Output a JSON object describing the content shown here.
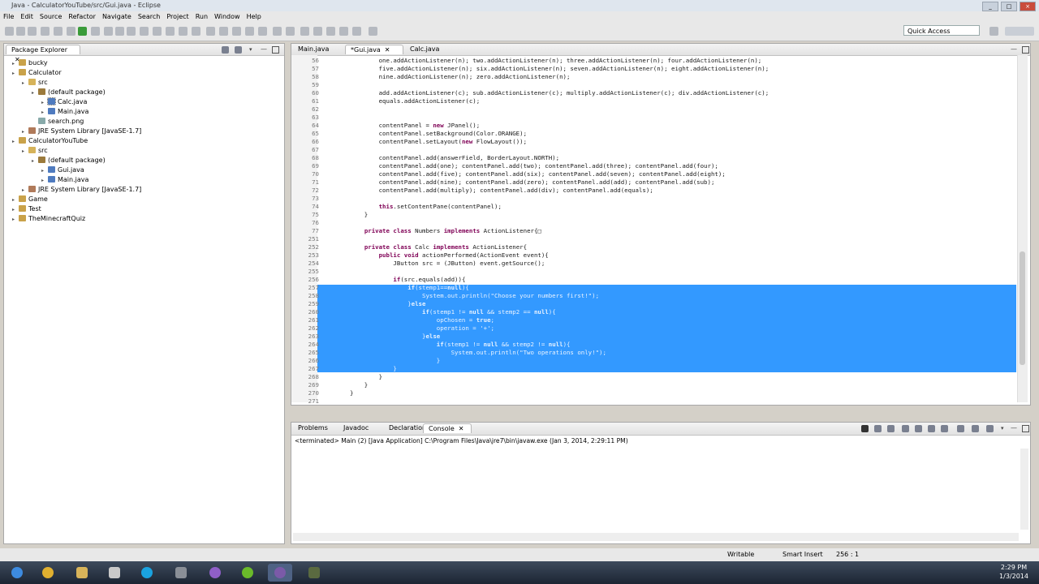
{
  "window": {
    "title": "Java - CalculatorYouTube/src/Gui.java - Eclipse",
    "title_clip": "CalculatorYouTube/src/Gui.java - Eclipse"
  },
  "menu": [
    "File",
    "Edit",
    "Source",
    "Refactor",
    "Navigate",
    "Search",
    "Project",
    "Run",
    "Window",
    "Help"
  ],
  "toolbar": {
    "quick_access": "Quick Access"
  },
  "package_explorer": {
    "tab_label": "Package Explorer",
    "tree": [
      {
        "label": "bucky",
        "depth": 0,
        "icon": "project-icon"
      },
      {
        "label": "Calculator",
        "depth": 0,
        "icon": "project-icon"
      },
      {
        "label": "src",
        "depth": 1,
        "icon": "source-folder-icon"
      },
      {
        "label": "(default package)",
        "depth": 2,
        "icon": "package-icon"
      },
      {
        "label": "Calc.java",
        "depth": 3,
        "icon": "java-file-icon"
      },
      {
        "label": "Main.java",
        "depth": 3,
        "icon": "java-file-icon"
      },
      {
        "label": "search.png",
        "depth": 2,
        "icon": "image-file-icon"
      },
      {
        "label": "JRE System Library [JavaSE-1.7]",
        "depth": 1,
        "icon": "library-icon"
      },
      {
        "label": "CalculatorYouTube",
        "depth": 0,
        "icon": "project-icon"
      },
      {
        "label": "src",
        "depth": 1,
        "icon": "source-folder-icon"
      },
      {
        "label": "(default package)",
        "depth": 2,
        "icon": "package-icon"
      },
      {
        "label": "Gui.java",
        "depth": 3,
        "icon": "java-file-icon"
      },
      {
        "label": "Main.java",
        "depth": 3,
        "icon": "java-file-icon"
      },
      {
        "label": "JRE System Library [JavaSE-1.7]",
        "depth": 1,
        "icon": "library-icon"
      },
      {
        "label": "Game",
        "depth": 0,
        "icon": "project-icon"
      },
      {
        "label": "Test",
        "depth": 0,
        "icon": "project-icon"
      },
      {
        "label": "TheMinecraftQuiz",
        "depth": 0,
        "icon": "project-icon"
      }
    ]
  },
  "editor": {
    "tabs": [
      "Main.java",
      "*Gui.java",
      "Calc.java"
    ],
    "active_tab": 1,
    "lines": [
      {
        "n": "56",
        "code": "        one.addActionListener(n); two.addActionListener(n); three.addActionListener(n); four.addActionListener(n);"
      },
      {
        "n": "57",
        "code": "        five.addActionListener(n); six.addActionListener(n); seven.addActionListener(n); eight.addActionListener(n);"
      },
      {
        "n": "58",
        "code": "        nine.addActionListener(n); zero.addActionListener(n);"
      },
      {
        "n": "59",
        "code": ""
      },
      {
        "n": "60",
        "code": "        add.addActionListener(c); sub.addActionListener(c); multiply.addActionListener(c); div.addActionListener(c);"
      },
      {
        "n": "61",
        "code": "        equals.addActionListener(c);"
      },
      {
        "n": "62",
        "code": ""
      },
      {
        "n": "63",
        "code": ""
      },
      {
        "n": "64",
        "code": "        contentPanel = new JPanel();"
      },
      {
        "n": "65",
        "code": "        contentPanel.setBackground(Color.ORANGE);"
      },
      {
        "n": "66",
        "code": "        contentPanel.setLayout(new FlowLayout());"
      },
      {
        "n": "67",
        "code": ""
      },
      {
        "n": "68",
        "code": "        contentPanel.add(answerField, BorderLayout.NORTH);"
      },
      {
        "n": "69",
        "code": "        contentPanel.add(one); contentPanel.add(two); contentPanel.add(three); contentPanel.add(four);"
      },
      {
        "n": "70",
        "code": "        contentPanel.add(five); contentPanel.add(six); contentPanel.add(seven); contentPanel.add(eight);"
      },
      {
        "n": "71",
        "code": "        contentPanel.add(nine); contentPanel.add(zero); contentPanel.add(add); contentPanel.add(sub);"
      },
      {
        "n": "72",
        "code": "        contentPanel.add(multiply); contentPanel.add(div); contentPanel.add(equals);"
      },
      {
        "n": "73",
        "code": ""
      },
      {
        "n": "74",
        "code": "        this.setContentPane(contentPanel);"
      },
      {
        "n": "75",
        "code": "    }"
      },
      {
        "n": "76",
        "code": ""
      },
      {
        "n": "77",
        "code": "    private class Numbers implements ActionListener{□"
      },
      {
        "n": "251",
        "code": ""
      },
      {
        "n": "252",
        "code": "    private class Calc implements ActionListener{"
      },
      {
        "n": "253",
        "code": "        public void actionPerformed(ActionEvent event){"
      },
      {
        "n": "254",
        "code": "            JButton src = (JButton) event.getSource();"
      },
      {
        "n": "255",
        "code": ""
      },
      {
        "n": "256",
        "code": "            if(src.equals(add)){"
      },
      {
        "n": "257",
        "code": "                if(stemp1==null){"
      },
      {
        "n": "258",
        "code": "                    System.out.println(\"Choose your numbers first!\");"
      },
      {
        "n": "259",
        "code": "                }else"
      },
      {
        "n": "260",
        "code": "                    if(stemp1 != null && stemp2 == null){"
      },
      {
        "n": "261",
        "code": "                        opChosen = true;"
      },
      {
        "n": "262",
        "code": "                        operation = '+';"
      },
      {
        "n": "263",
        "code": "                    }else"
      },
      {
        "n": "264",
        "code": "                        if(stemp1 != null && stemp2 != null){"
      },
      {
        "n": "265",
        "code": "                            System.out.println(\"Two operations only!\");"
      },
      {
        "n": "266",
        "code": "                        }"
      },
      {
        "n": "267",
        "code": "            }"
      },
      {
        "n": "268",
        "code": "        }"
      },
      {
        "n": "269",
        "code": "    }"
      },
      {
        "n": "270",
        "code": "}"
      },
      {
        "n": "271",
        "code": ""
      }
    ]
  },
  "bottom": {
    "tabs": [
      "Problems",
      "Javadoc",
      "Declaration",
      "Console"
    ],
    "active_tab": 3,
    "console_status": "<terminated> Main (2) [Java Application] C:\\Program Files\\Java\\jre7\\bin\\javaw.exe (Jan 3, 2014, 2:29:11 PM)"
  },
  "status": {
    "writable": "Writable",
    "insert_mode": "Smart Insert",
    "cursor": "256 : 1"
  },
  "taskbar": {
    "time": "2:29 PM",
    "date": "1/3/2014"
  },
  "colors": {
    "selection": "#3399ff",
    "keyword": "#7f0055"
  }
}
